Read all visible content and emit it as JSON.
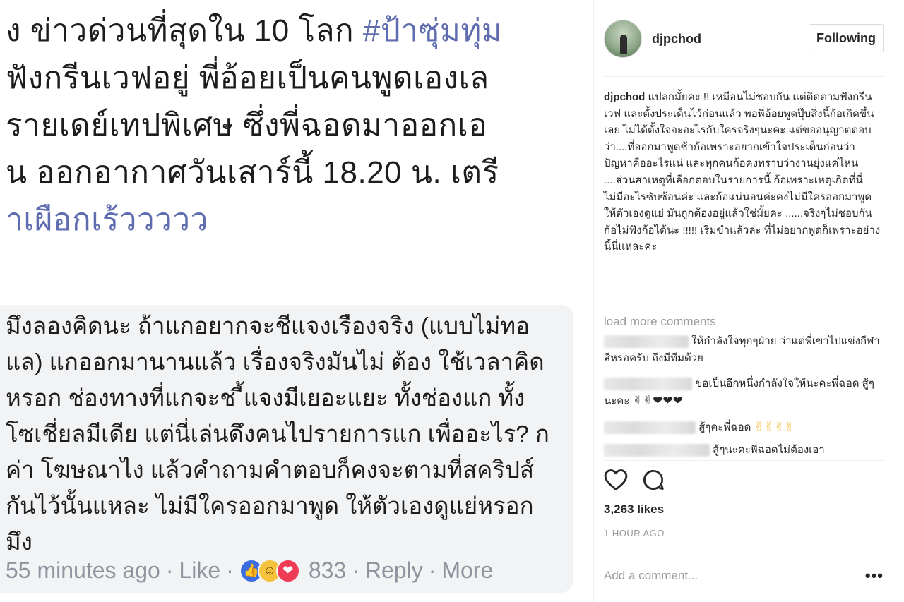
{
  "facebook": {
    "post_lines": [
      {
        "text": "ง ข่าวด่วนที่สุดใน 10 โลก ",
        "hashtag": "#ป้าซุ่มทุ่ม"
      },
      {
        "text": "ฟังกรีนเวฟอยู่ พี่อ้อยเป็นคนพูดเองเล",
        "hashtag": ""
      },
      {
        "text": "รายเดย์เทปพิเศษ ซึ่งพี่ฉอดมาออกเอ",
        "hashtag": ""
      },
      {
        "text": "น ออกอากาศวันเสาร์นี้ 18.20 น. เตรี",
        "hashtag": ""
      }
    ],
    "post_tag_line": "าเผือกเร้ววววว",
    "comment_lines": [
      "มึงลองคิดนะ ถ้าแกอยากจะชีแจงเรืองจริง (แบบไม่ทอ",
      "แล) แกออกมานานแล้ว เรื่องจริงมันไม่ ต้อง ใช้เวลาคิด",
      "หรอก ช่องทางที่แกจะช ี้แจงมีเยอะแยะ ทั้งช่องแก ทั้ง",
      "โซเชี่ยลมีเดีย แต่นี่เล่นดึงคนไปรายการแก เพื่ออะไร? ก",
      "ค่า โฆษณาไง แล้วคำถามคำตอบก็คงจะตามที่สคริปส์",
      "กันไว้นั้นแหละ ไม่มีใครออกมาพูด ให้ตัวเองดูแย่หรอก",
      "มึง"
    ],
    "comment_meta": {
      "time": "55 minutes ago",
      "like": "Like",
      "reaction_count": "833",
      "reply": "Reply",
      "more": "More",
      "separator": "·"
    }
  },
  "instagram": {
    "username": "djpchod",
    "follow_label": "Following",
    "caption_user": "djpchod",
    "caption_text": "แปลกมั้ยคะ !! เหมือนไม่ชอบกัน แต่ติดตามฟังกรีนเวฟ และตั้งประเด็นไว้ก่อนแล้ว พอพี่อ้อยพูดปุ๊บสิ่งนี้ก้อเกิดขึ้นเลย ไม่ได้ตั้งใจจะอะไรกับใครจริงๆนะคะ แต่ขออนุญาตตอบว่า....ที่ออกมาพูดช้าก้อเพราะอยากเข้าใจประเด็นก่อนว่าปัญหาคืออะไรแน่ และทุกคนก้อคงทราบว่างานยุ่งแค่ไหน ....ส่วนสาเหตุที่เลือกตอบในรายการนี้ ก้อเพราะเหตุเกิดที่นี่ ไม่มีอะไรซับซ้อนค่ะ และก้อแน่นอนค่ะคงไม่มีใครออกมาพูด ให้ตัวเองดูแย่ มันถูกต้องอยู่แล้วใช่มั้ยคะ ......จริงๆไม่ชอบกันก้อไม่ฟังก้อได้นะ !!!!! เริ่มขำแล้วล่ะ ที่ไม่อยากพูดก็เพราะอย่างนี้นี่แหละค่ะ",
    "load_more": "load more comments",
    "comments": [
      {
        "text": "ให้กำลังใจทุกๆฝ่าย ว่าแต่พี่เขาไปแข่งกีฬาสีหรอครับ ถึงมีทีมด้วย",
        "emoji": ""
      },
      {
        "text": "ขอเป็นอีกหนึ่งกำลังใจให้นะคะพี่ฉอด สู้ๆนะคะ",
        "emoji": "✌✌❤❤❤"
      },
      {
        "text": "สู้ๆคะพี่ฉอด",
        "emoji": "✌✌✌✌"
      },
      {
        "text": "สู้ๆนะคะพี่ฉอดไม่ต้องเอา",
        "emoji": ""
      }
    ],
    "likes": "3,263 likes",
    "time_ago": "1 HOUR AGO",
    "add_comment_placeholder": "Add a comment...",
    "more_options": "•••"
  }
}
